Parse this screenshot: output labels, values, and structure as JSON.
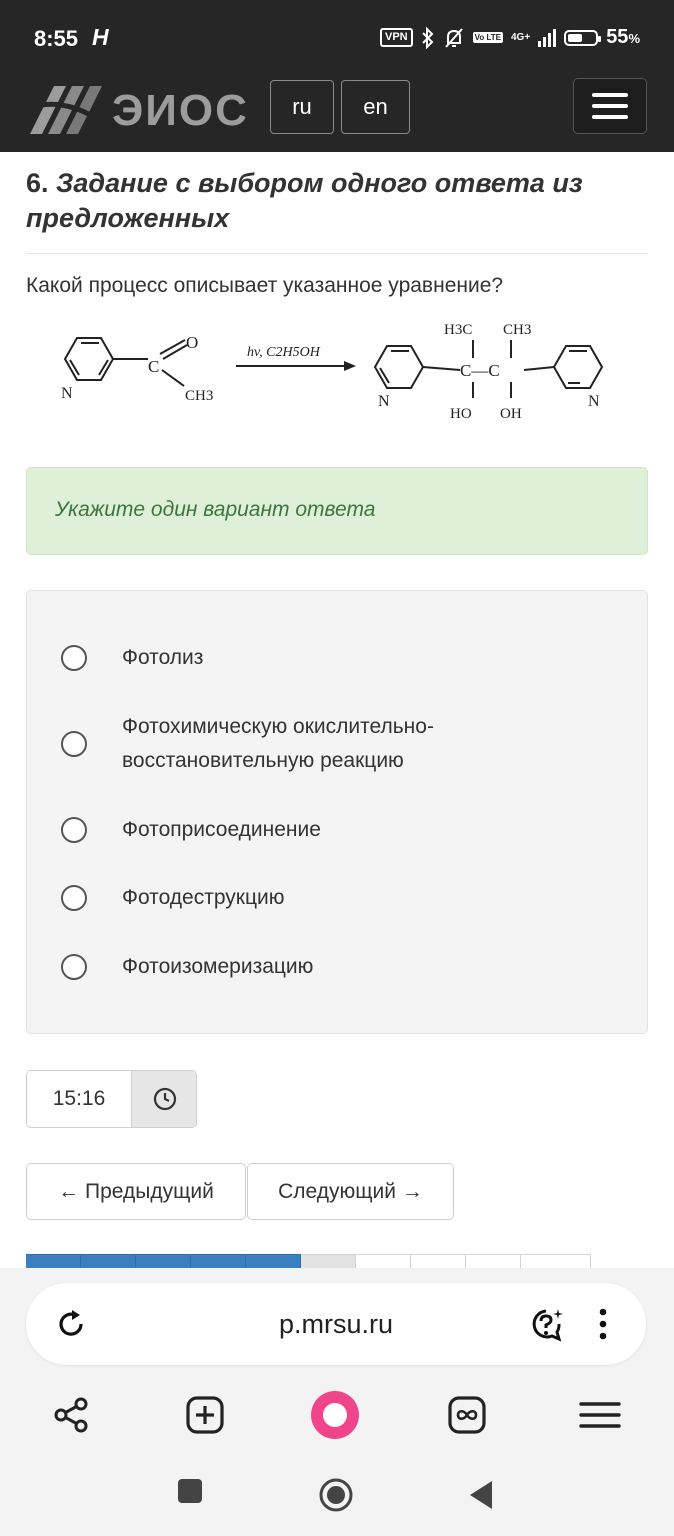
{
  "status": {
    "time": "8:55",
    "h_icon": "Н",
    "vpn": "VPN",
    "lte": "Vo LTE",
    "network": "4G+",
    "battery_pct": 55,
    "battery_text": "55",
    "battery_unit": "%"
  },
  "header": {
    "logo": "ЭИОС",
    "lang_ru": "ru",
    "lang_en": "en"
  },
  "question": {
    "number": "6.",
    "title": "Задание с выбором одного ответа из предложенных",
    "text": "Какой процесс описывает указанное уравнение?",
    "equation": {
      "reactant_o": "O",
      "reactant_c": "C",
      "reactant_ch3": "CH3",
      "reactant_n": "N",
      "conditions": "hv, C2H5OH",
      "product_h3c": "H3C",
      "product_ch3": "CH3",
      "product_chain": "C—C",
      "product_ho": "HO",
      "product_oh": "OH",
      "product_n_left": "N",
      "product_n_right": "N"
    }
  },
  "hint": "Укажите один вариант ответа",
  "answers": [
    {
      "label": "Фотолиз"
    },
    {
      "label": "Фотохимическую окислительно-восстановительную реакцию"
    },
    {
      "label": "Фотоприсоединение"
    },
    {
      "label": "Фотодеструкцию"
    },
    {
      "label": "Фотоизомеризацию"
    }
  ],
  "timer": "15:16",
  "nav": {
    "prev": "← Предыдущий",
    "next": "Следующий →"
  },
  "browser": {
    "url": "p.mrsu.ru"
  },
  "icons": {
    "reload": "reload-icon",
    "assistant": "assistant-question-icon",
    "more": "more-vertical-icon",
    "share": "share-icon",
    "new_tab": "plus-box-icon",
    "alice": "alice-icon",
    "tabs": "infinity-tabs-icon",
    "menu": "menu-icon"
  },
  "colors": {
    "dark": "#262626",
    "hint_bg": "#dff0d8",
    "hint_text": "#3c763d",
    "page_done": "#3a7fc0",
    "alice": "#f0458b"
  }
}
